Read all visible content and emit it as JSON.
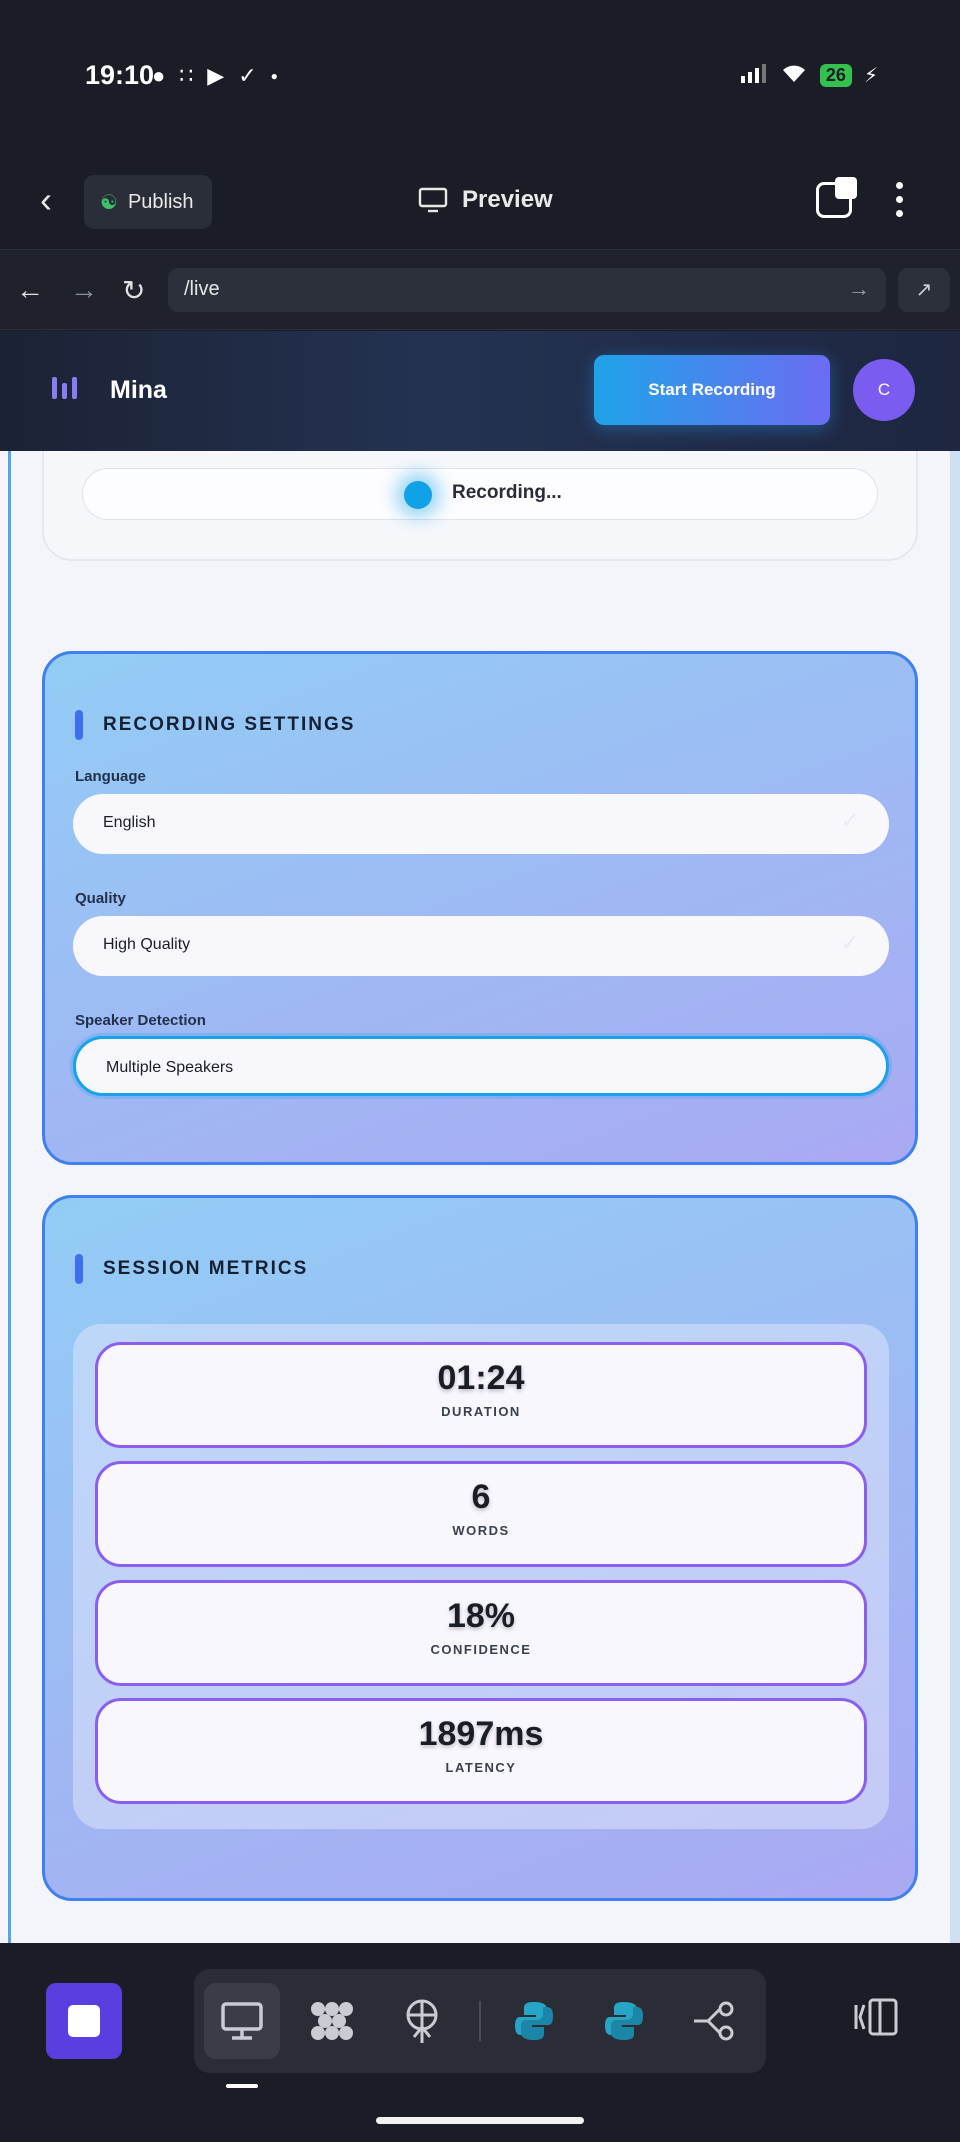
{
  "status_bar": {
    "time": "19:10",
    "battery": "26",
    "left_icons": [
      "chat-icon",
      "dots-grid-icon",
      "youtube-icon",
      "check-circle-icon",
      "dot-icon"
    ],
    "right_icons": [
      "signal-icon",
      "wifi-icon",
      "battery-icon",
      "charging-icon"
    ]
  },
  "app_header": {
    "publish_label": "Publish",
    "preview_label": "Preview"
  },
  "url_bar": {
    "url": "/live"
  },
  "site": {
    "brand": "Mina",
    "start_recording_label": "Start Recording",
    "avatar_initial": "C",
    "accent_color": "#3f7ff2"
  },
  "recording": {
    "status_text": "Recording..."
  },
  "settings": {
    "title": "RECORDING SETTINGS",
    "language": {
      "label": "Language",
      "value": "English"
    },
    "quality": {
      "label": "Quality",
      "value": "High Quality"
    },
    "speaker_detection": {
      "label": "Speaker Detection",
      "value": "Multiple Speakers"
    }
  },
  "metrics": {
    "title": "SESSION METRICS",
    "items": [
      {
        "value": "01:24",
        "label": "DURATION"
      },
      {
        "value": "6",
        "label": "WORDS"
      },
      {
        "value": "18%",
        "label": "CONFIDENCE"
      },
      {
        "value": "1897ms",
        "label": "LATENCY"
      }
    ]
  },
  "dock": {
    "tools": [
      "monitor-icon",
      "blocks-icon",
      "antenna-icon",
      "python-icon",
      "python-icon",
      "flow-icon"
    ]
  }
}
